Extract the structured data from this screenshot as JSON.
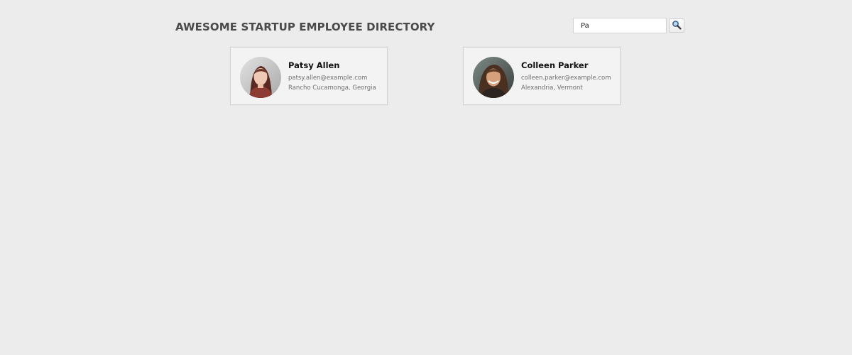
{
  "header": {
    "title": "AWESOME STARTUP EMPLOYEE DIRECTORY"
  },
  "search": {
    "value": "Pa",
    "icon": "magnifier-icon"
  },
  "employees": [
    {
      "name": "Patsy Allen",
      "email": "patsy.allen@example.com",
      "location": "Rancho Cucamonga, Georgia"
    },
    {
      "name": "Colleen Parker",
      "email": "colleen.parker@example.com",
      "location": "Alexandria, Vermont"
    }
  ],
  "colors": {
    "background": "#ececec",
    "card": "#f3f3f3",
    "card_border": "#d3d3d3",
    "title": "#4a4a4a"
  }
}
